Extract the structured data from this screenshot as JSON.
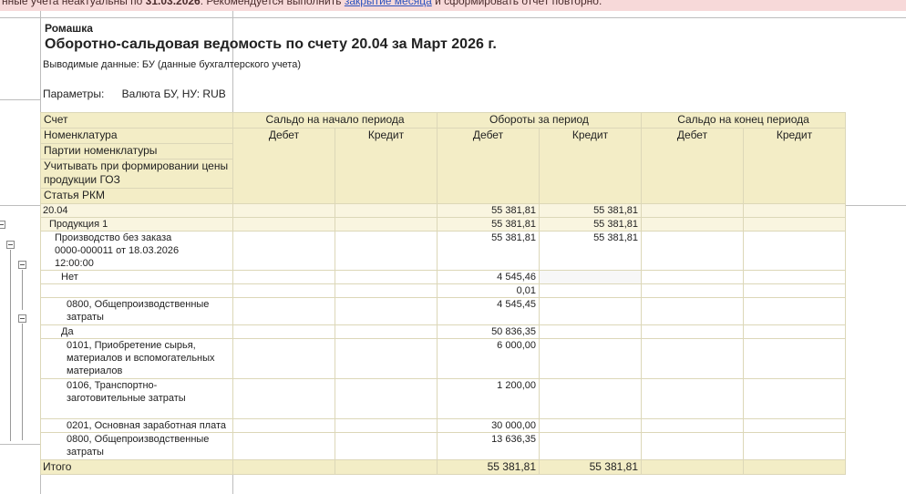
{
  "warning": {
    "part1": "нные учета неактуальны по",
    "date": "31.03.2026",
    "part2": ". Рекомендуется выполнить",
    "link": "закрытие месяца",
    "part3": "и сформировать отчет повторно."
  },
  "report": {
    "org": "Ромашка",
    "title": "Оборотно-сальдовая ведомость по счету 20.04 за Март 2026 г.",
    "subtitle": "Выводимые данные: БУ (данные бухгалтерского учета)",
    "params_label": "Параметры:",
    "params_value": "Валюта БУ, НУ: RUB"
  },
  "header": {
    "row_labels": [
      "Счет",
      "Номенклатура",
      "Партии номенклатуры",
      "Учитывать при формировании цены продукции ГОЗ",
      "Статья РКМ"
    ],
    "groups": [
      "Сальдо на начало периода",
      "Обороты за период",
      "Сальдо на конец периода"
    ],
    "debit": "Дебет",
    "credit": "Кредит"
  },
  "rows": [
    {
      "name": "20.04",
      "turn_debit": "55 381,81",
      "turn_credit": "55 381,81"
    },
    {
      "name": "Продукция 1",
      "turn_debit": "55 381,81",
      "turn_credit": "55 381,81"
    },
    {
      "name": "Производство без заказа 0000-000011 от 18.03.2026 12:00:00",
      "turn_debit": "55 381,81",
      "turn_credit": "55 381,81"
    },
    {
      "name": "Нет",
      "turn_debit": "4 545,46",
      "turn_credit": ""
    },
    {
      "name": "",
      "turn_debit": "0,01",
      "turn_credit": ""
    },
    {
      "name": "0800, Общепроизводственные затраты",
      "turn_debit": "4 545,45",
      "turn_credit": ""
    },
    {
      "name": "Да",
      "turn_debit": "50 836,35",
      "turn_credit": ""
    },
    {
      "name": "0101, Приобретение сырья, материалов и вспомогательных материалов",
      "turn_debit": "6 000,00",
      "turn_credit": ""
    },
    {
      "name": "0106, Транспортно-заготовительные затраты",
      "turn_debit": "1 200,00",
      "turn_credit": ""
    },
    {
      "name": "0201, Основная заработная плата",
      "turn_debit": "30 000,00",
      "turn_credit": ""
    },
    {
      "name": "0800, Общепроизводственные затраты",
      "turn_debit": "13 636,35",
      "turn_credit": ""
    }
  ],
  "total": {
    "label": "Итого",
    "turn_debit": "55 381,81",
    "turn_credit": "55 381,81"
  },
  "icons": {
    "collapse": "minus-square-icon"
  }
}
